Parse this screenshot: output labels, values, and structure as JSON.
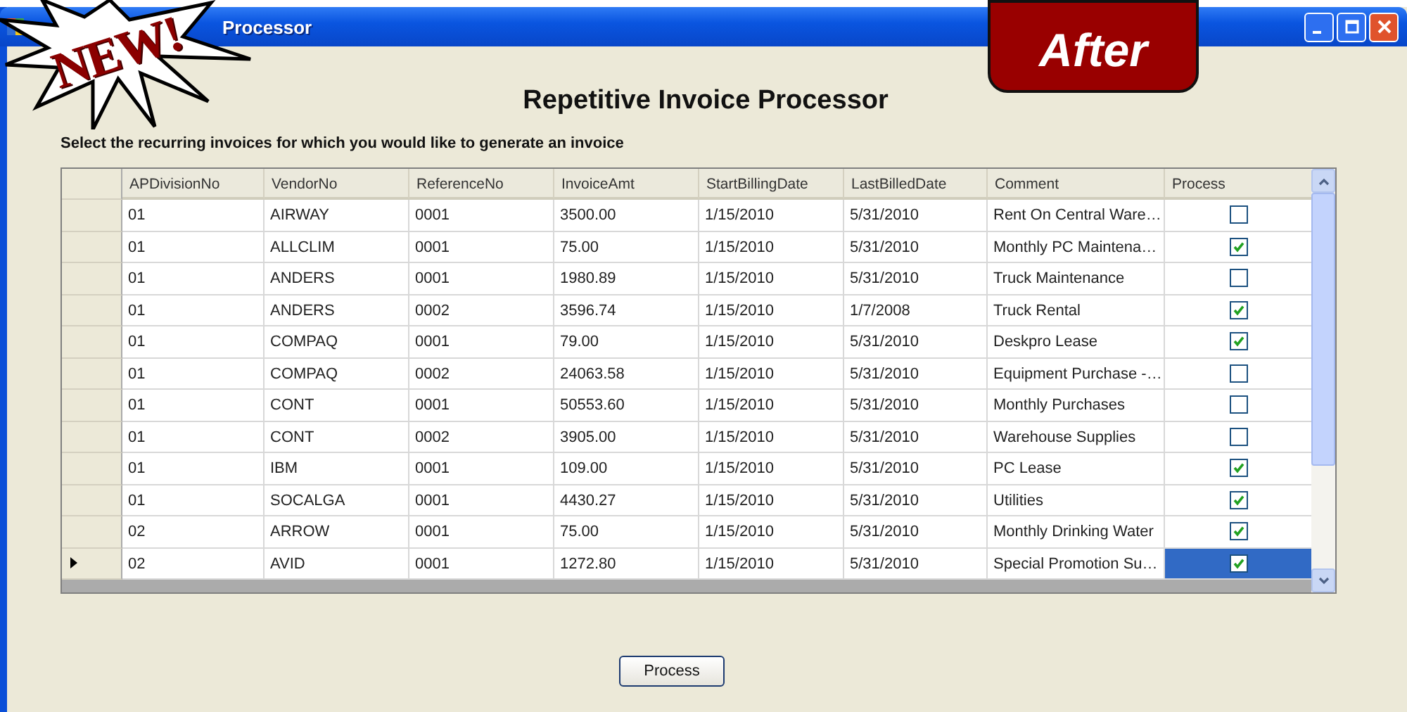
{
  "window": {
    "title": "Processor"
  },
  "overlays": {
    "new_badge": "NEW!",
    "after_badge": "After"
  },
  "heading": "Repetitive Invoice Processor",
  "instruction": "Select the recurring invoices for which you would like to generate an invoice",
  "table": {
    "columns": [
      "APDivisionNo",
      "VendorNo",
      "ReferenceNo",
      "InvoiceAmt",
      "StartBillingDate",
      "LastBilledDate",
      "Comment",
      "Process"
    ],
    "rows": [
      {
        "cells": [
          "01",
          "AIRWAY",
          "0001",
          "3500.00",
          "1/15/2010",
          "5/31/2010",
          "Rent On Central Ware…"
        ],
        "process": false,
        "selected": false
      },
      {
        "cells": [
          "01",
          "ALLCLIM",
          "0001",
          "75.00",
          "1/15/2010",
          "5/31/2010",
          "Monthly PC Maintena…"
        ],
        "process": true,
        "selected": false
      },
      {
        "cells": [
          "01",
          "ANDERS",
          "0001",
          "1980.89",
          "1/15/2010",
          "5/31/2010",
          "Truck Maintenance"
        ],
        "process": false,
        "selected": false
      },
      {
        "cells": [
          "01",
          "ANDERS",
          "0002",
          "3596.74",
          "1/15/2010",
          "1/7/2008",
          "Truck Rental"
        ],
        "process": true,
        "selected": false
      },
      {
        "cells": [
          "01",
          "COMPAQ",
          "0001",
          "79.00",
          "1/15/2010",
          "5/31/2010",
          "Deskpro Lease"
        ],
        "process": true,
        "selected": false
      },
      {
        "cells": [
          "01",
          "COMPAQ",
          "0002",
          "24063.58",
          "1/15/2010",
          "5/31/2010",
          "Equipment Purchase -…"
        ],
        "process": false,
        "selected": false
      },
      {
        "cells": [
          "01",
          "CONT",
          "0001",
          "50553.60",
          "1/15/2010",
          "5/31/2010",
          "Monthly Purchases"
        ],
        "process": false,
        "selected": false
      },
      {
        "cells": [
          "01",
          "CONT",
          "0002",
          "3905.00",
          "1/15/2010",
          "5/31/2010",
          "Warehouse Supplies"
        ],
        "process": false,
        "selected": false
      },
      {
        "cells": [
          "01",
          "IBM",
          "0001",
          "109.00",
          "1/15/2010",
          "5/31/2010",
          "PC Lease"
        ],
        "process": true,
        "selected": false
      },
      {
        "cells": [
          "01",
          "SOCALGA",
          "0001",
          "4430.27",
          "1/15/2010",
          "5/31/2010",
          "Utilities"
        ],
        "process": true,
        "selected": false
      },
      {
        "cells": [
          "02",
          "ARROW",
          "0001",
          "75.00",
          "1/15/2010",
          "5/31/2010",
          "Monthly Drinking Water"
        ],
        "process": true,
        "selected": false
      },
      {
        "cells": [
          "02",
          "AVID",
          "0001",
          "1272.80",
          "1/15/2010",
          "5/31/2010",
          "Special Promotion Su…"
        ],
        "process": true,
        "selected": true
      }
    ]
  },
  "buttons": [
    "Process"
  ]
}
